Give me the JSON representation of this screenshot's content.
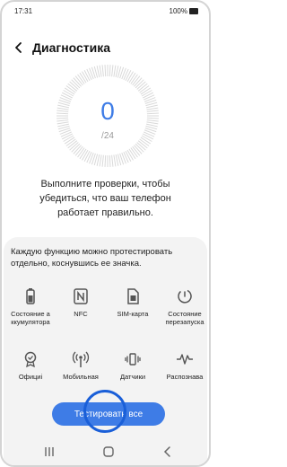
{
  "status_bar": {
    "time": "17:31",
    "battery": "100%"
  },
  "header": {
    "title": "Диагностика"
  },
  "progress": {
    "completed": "0",
    "total": "/24"
  },
  "instruction": "Выполните проверки, чтобы убедиться, что ваш телефон работает правильно.",
  "hint": "Каждую функцию можно протестировать отдельно, коснувшись ее значка.",
  "tiles_row1": [
    {
      "label": "Состояние а\nккумулятора",
      "icon": "battery-icon"
    },
    {
      "label": "NFC",
      "icon": "nfc-icon"
    },
    {
      "label": "SIM-карта",
      "icon": "sim-card-icon"
    },
    {
      "label": "Состояние\nперезапуска",
      "icon": "restart-icon"
    }
  ],
  "tiles_row2": [
    {
      "label": "Официі",
      "icon": "badge-icon"
    },
    {
      "label": "Мобильная",
      "icon": "antenna-icon"
    },
    {
      "label": "Датчики",
      "icon": "vibration-icon"
    },
    {
      "label": "Распознава",
      "icon": "waveform-icon"
    }
  ],
  "primary_button": "Тестировать все",
  "colors": {
    "accent": "#3e7ce6",
    "sheet": "#f3f3f3",
    "tap_ring": "#1a5fd8"
  }
}
